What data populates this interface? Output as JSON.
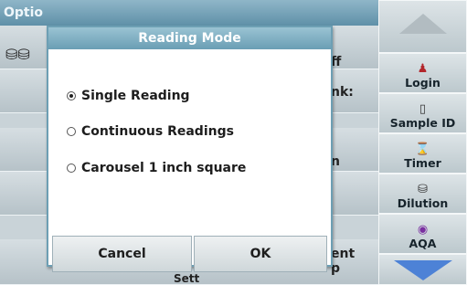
{
  "background": {
    "title": "Optio",
    "row1_text": "ff",
    "row2_text": "nk:",
    "row3_text": "n",
    "row5_text_a": "ent",
    "row5_text_b": "p",
    "bottom_text": "Sett"
  },
  "sidebar": {
    "items": [
      {
        "label": "",
        "icon": "arrow-up-icon"
      },
      {
        "label": "Login",
        "icon": "person-icon",
        "glyph": "🯅"
      },
      {
        "label": "Sample ID",
        "icon": "sample-icon",
        "glyph": "⌂"
      },
      {
        "label": "Timer",
        "icon": "timer-icon",
        "glyph": "⌚"
      },
      {
        "label": "Dilution",
        "icon": "dilution-icon",
        "glyph": "⛁"
      },
      {
        "label": "AQA",
        "icon": "aqa-icon",
        "glyph": "◉"
      },
      {
        "label": "",
        "icon": "arrow-down-icon"
      }
    ]
  },
  "dialog": {
    "title": "Reading Mode",
    "options": [
      {
        "label": "Single Reading",
        "selected": true
      },
      {
        "label": "Continuous Readings",
        "selected": false
      },
      {
        "label": "Carousel 1 inch square",
        "selected": false
      }
    ],
    "cancel_label": "Cancel",
    "ok_label": "OK"
  },
  "colors": {
    "title_bar": "#6a9eb4",
    "scroll_arrow": "#4d82d6"
  }
}
